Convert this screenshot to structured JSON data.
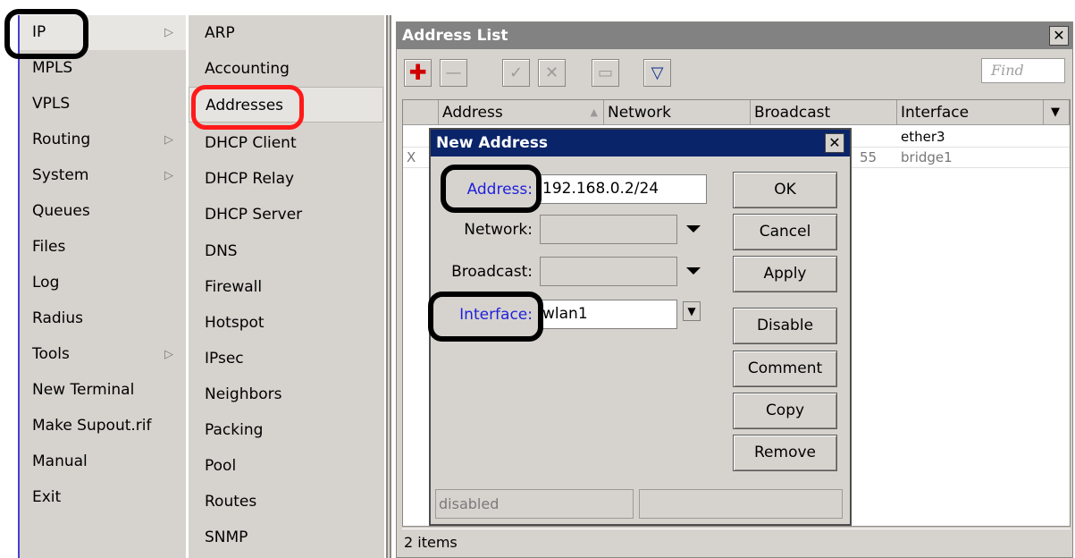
{
  "main_menu": [
    {
      "label": "IP",
      "has_arrow": true
    },
    {
      "label": "MPLS",
      "has_arrow": false
    },
    {
      "label": "VPLS",
      "has_arrow": false
    },
    {
      "label": "Routing",
      "has_arrow": true
    },
    {
      "label": "System",
      "has_arrow": true
    },
    {
      "label": "Queues",
      "has_arrow": false
    },
    {
      "label": "Files",
      "has_arrow": false
    },
    {
      "label": "Log",
      "has_arrow": false
    },
    {
      "label": "Radius",
      "has_arrow": false
    },
    {
      "label": "Tools",
      "has_arrow": true
    },
    {
      "label": "New Terminal",
      "has_arrow": false
    },
    {
      "label": "Make Supout.rif",
      "has_arrow": false
    },
    {
      "label": "Manual",
      "has_arrow": false
    },
    {
      "label": "Exit",
      "has_arrow": false
    }
  ],
  "ip_submenu": [
    "ARP",
    "Accounting",
    "Addresses",
    "DHCP Client",
    "DHCP Relay",
    "DHCP Server",
    "DNS",
    "Firewall",
    "Hotspot",
    "IPsec",
    "Neighbors",
    "Packing",
    "Pool",
    "Routes",
    "SNMP"
  ],
  "address_list": {
    "title": "Address List",
    "close_glyph": "✕",
    "find_placeholder": "Find",
    "columns": [
      "Address",
      "Network",
      "Broadcast",
      "Interface"
    ],
    "sort_glyph": "▲",
    "rows": [
      {
        "flag": "",
        "address": "",
        "network": "",
        "broadcast": "",
        "interface": "ether3",
        "disabled": false
      },
      {
        "flag": "X",
        "address": "",
        "network": "",
        "broadcast": "55",
        "interface": "bridge1",
        "disabled": true
      }
    ],
    "status": "2 items"
  },
  "new_address_dialog": {
    "title": "New Address",
    "close_glyph": "✕",
    "address_label": "Address:",
    "address_value": "192.168.0.2/24",
    "network_label": "Network:",
    "network_value": "",
    "broadcast_label": "Broadcast:",
    "broadcast_value": "",
    "interface_label": "Interface:",
    "interface_value": "wlan1",
    "buttons": {
      "ok": "OK",
      "cancel": "Cancel",
      "apply": "Apply",
      "disable": "Disable",
      "comment": "Comment",
      "copy": "Copy",
      "remove": "Remove"
    },
    "status_left": "disabled",
    "status_right": ""
  },
  "toolbar_icons": [
    "plus-icon",
    "minus-icon",
    "check-icon",
    "cross-icon",
    "note-icon",
    "filter-icon"
  ],
  "colors": {
    "highlight_black": "#000000",
    "highlight_red": "#ff0000",
    "dialog_title": "#0a246a",
    "label_blue": "#1f1fdd"
  }
}
